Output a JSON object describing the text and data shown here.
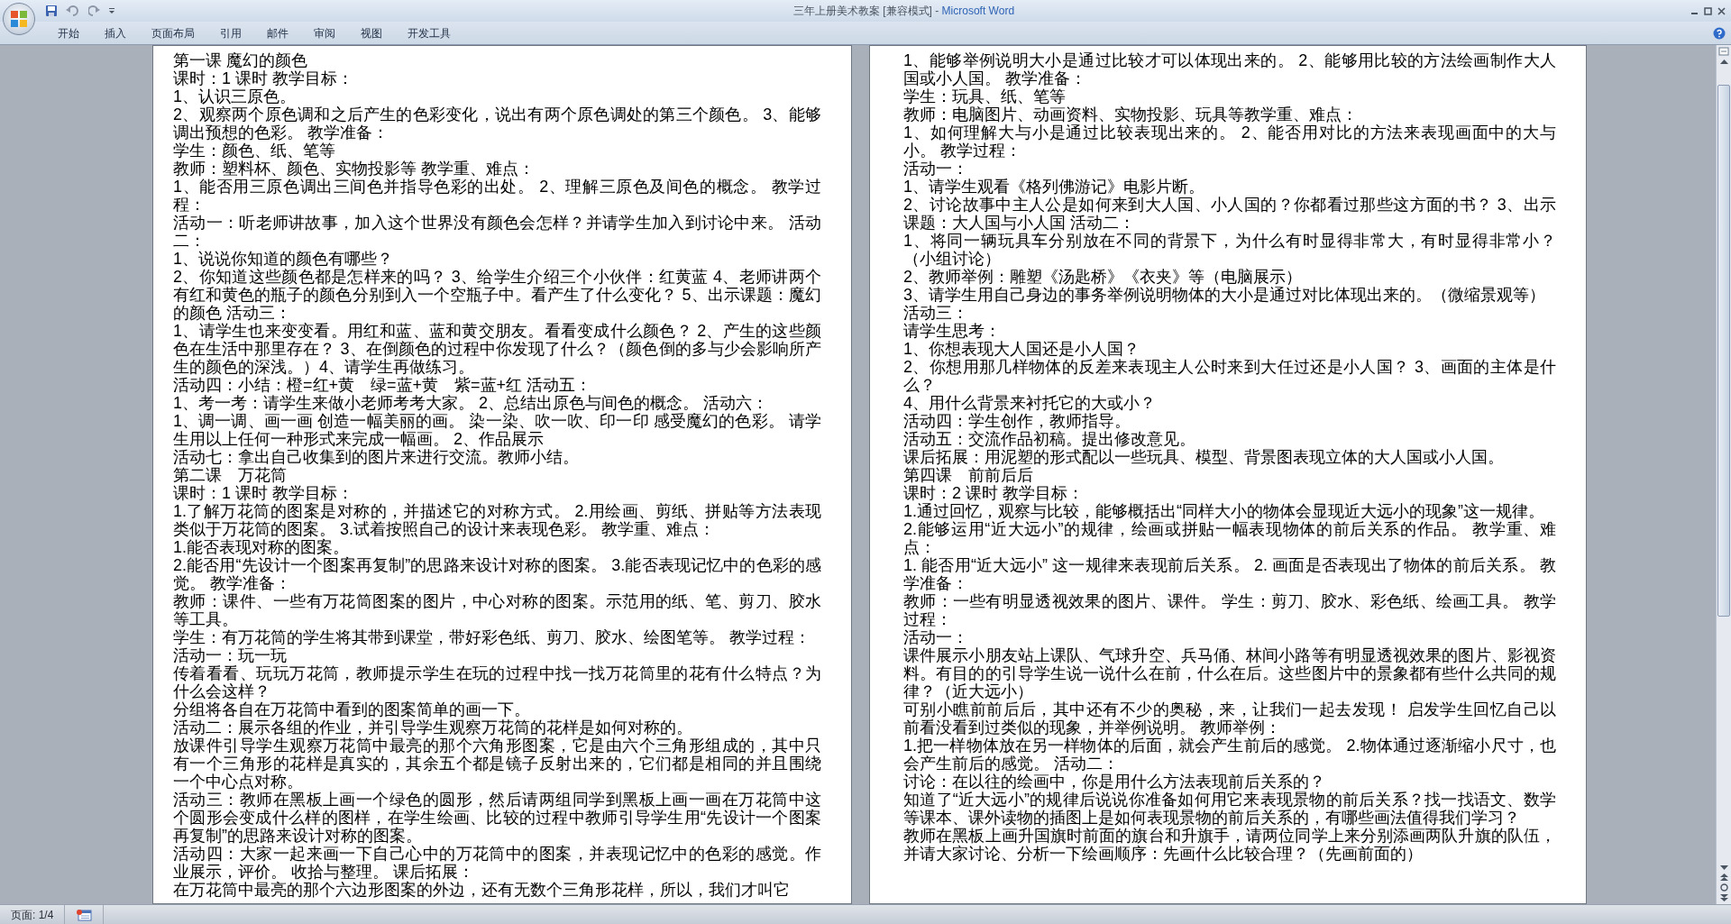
{
  "window": {
    "title": "三年上册美术教案 [兼容模式] -",
    "app": "Microsoft Word"
  },
  "ribbon_tabs": [
    {
      "label": "开始",
      "selected": false
    },
    {
      "label": "插入",
      "selected": false
    },
    {
      "label": "页面布局",
      "selected": false
    },
    {
      "label": "引用",
      "selected": false
    },
    {
      "label": "邮件",
      "selected": false
    },
    {
      "label": "审阅",
      "selected": false
    },
    {
      "label": "视图",
      "selected": false
    },
    {
      "label": "开发工具",
      "selected": false
    }
  ],
  "pages": [
    {
      "paragraphs": [
        "第一课 魔幻的颜色",
        "课时：1 课时 教学目标：",
        "1、认识三原色。",
        "2、观察两个原色调和之后产生的色彩变化，说出有两个原色调处的第三个颜色。 3、能够调出预想的色彩。 教学准备：",
        "学生：颜色、纸、笔等",
        "教师：塑料杯、颜色、实物投影等 教学重、难点：",
        "1、能否用三原色调出三间色并指导色彩的出处。 2、理解三原色及间色的概念。 教学过程：",
        "活动一：听老师讲故事，加入这个世界没有颜色会怎样？并请学生加入到讨论中来。 活动二：",
        "1、说说你知道的颜色有哪些？",
        "2、你知道这些颜色都是怎样来的吗？ 3、给学生介绍三个小伙伴：红黄蓝 4、老师讲两个有红和黄色的瓶子的颜色分别到入一个空瓶子中。看产生了什么变化？ 5、出示课题：魔幻的颜色 活动三：",
        "1、请学生也来变变看。用红和蓝、蓝和黄交朋友。看看变成什么颜色？ 2、产生的这些颜色在生活中那里存在？ 3、在倒颜色的过程中你发现了什么？（颜色倒的多与少会影响所产生的颜色的深浅。）4、请学生再做练习。",
        "活动四：小结：橙=红+黄　绿=蓝+黄　紫=蓝+红 活动五：",
        "1、考一考：请学生来做小老师考考大家。 2、总结出原色与间色的概念。 活动六：",
        "1、调一调、画一画 创造一幅美丽的画。 染一染、吹一吹、印一印 感受魔幻的色彩。 请学生用以上任何一种形式来完成一幅画。 2、作品展示",
        "活动七：拿出自己收集到的图片来进行交流。教师小结。",
        "第二课　万花筒",
        "课时：1 课时 教学目标：",
        "1.了解万花筒的图案是对称的，并描述它的对称方式。 2.用绘画、剪纸、拼贴等方法表现类似于万花筒的图案。 3.试着按照自己的设计来表现色彩。 教学重、难点：",
        "1.能否表现对称的图案。",
        "2.能否用“先设计一个图案再复制”的思路来设计对称的图案。 3.能否表现记忆中的色彩的感觉。 教学准备：",
        "教师：课件、一些有万花筒图案的图片，中心对称的图案。示范用的纸、笔、剪刀、胶水等工具。",
        "学生：有万花筒的学生将其带到课堂，带好彩色纸、剪刀、胶水、绘图笔等。 教学过程：",
        "活动一：玩一玩",
        "传着看看、玩玩万花筒，教师提示学生在玩的过程中找一找万花筒里的花有什么特点？为什么会这样？",
        "分组将各自在万花筒中看到的图案简单的画一下。",
        "活动二：展示各组的作业，并引导学生观察万花筒的花样是如何对称的。",
        "放课件引导学生观察万花筒中最亮的那个六角形图案，它是由六个三角形组成的，其中只有一个三角形的花样是真实的，其余五个都是镜子反射出来的，它们都是相同的并且围绕一个中心点对称。",
        "活动三：教师在黑板上画一个绿色的圆形，然后请两组同学到黑板上画一画在万花筒中这个圆形会变成什么样的图样，在学生绘画、比较的过程中教师引导学生用“先设计一个图案再复制”的思路来设计对称的图案。",
        "活动四：大家一起来画一下自己心中的万花筒中的图案，并表现记忆中的色彩的感觉。作业展示，评价。 收拾与整理。 课后拓展：",
        "在万花筒中最亮的那个六边形图案的外边，还有无数个三角形花样，所以，我们才叫它"
      ]
    },
    {
      "paragraphs": [
        "1、能够举例说明大小是通过比较才可以体现出来的。 2、能够用比较的方法绘画制作大人国或小人国。 教学准备：",
        "学生：玩具、纸、笔等",
        "教师：电脑图片、动画资料、实物投影、玩具等教学重、难点：",
        "1、如何理解大与小是通过比较表现出来的。 2、能否用对比的方法来表现画面中的大与小。 教学过程：",
        "活动一：",
        "1、请学生观看《格列佛游记》电影片断。",
        "2、讨论故事中主人公是如何来到大人国、小人国的？你都看过那些这方面的书？ 3、出示课题：大人国与小人国 活动二：",
        "1、将同一辆玩具车分别放在不同的背景下，为什么有时显得非常大，有时显得非常小？（小组讨论）",
        "2、教师举例：雕塑《汤匙桥》《衣夹》等（电脑展示）",
        "3、请学生用自己身边的事务举例说明物体的大小是通过对比体现出来的。（微缩景观等）",
        "活动三：",
        "请学生思考：",
        "1、你想表现大人国还是小人国？",
        "2、你想用那几样物体的反差来表现主人公时来到大任过还是小人国？ 3、画面的主体是什么？",
        "4、用什么背景来衬托它的大或小？",
        "活动四：学生创作，教师指导。",
        "活动五：交流作品初稿。提出修改意见。",
        "课后拓展：用泥塑的形式配以一些玩具、模型、背景图表现立体的大人国或小人国。",
        "第四课　前前后后",
        "课时：2 课时 教学目标：",
        "1.通过回忆，观察与比较，能够概括出“同样大小的物体会显现近大远小的现象”这一规律。",
        "2.能够运用“近大远小”的规律，绘画或拼贴一幅表现物体的前后关系的作品。 教学重、难点：",
        "1. 能否用“近大远小” 这一规律来表现前后关系。 2. 画面是否表现出了物体的前后关系。 教学准备：",
        "教师：一些有明显透视效果的图片、课件。 学生：剪刀、胶水、彩色纸、绘画工具。 教学过程：",
        "活动一：",
        "课件展示小朋友站上课队、气球升空、兵马俑、林间小路等有明显透视效果的图片、影视资料。有目的的引导学生说一说什么在前，什么在后。这些图片中的景象都有些什么共同的规律？（近大远小）",
        "可别小瞧前前后后，其中还有不少的奥秘，来，让我们一起去发现！ 启发学生回忆自己以前看没看到过类似的现象，并举例说明。 教师举例：",
        "1.把一样物体放在另一样物体的后面，就会产生前后的感觉。 2.物体通过逐渐缩小尺寸，也会产生前后的感觉。 活动二：",
        "讨论：在以往的绘画中，你是用什么方法表现前后关系的？",
        "知道了“近大远小”的规律后说说你准备如何用它来表现景物的前后关系？找一找语文、数学等课本、课外读物的插图上是如何表现景物的前后关系的，有哪些画法值得我们学习？",
        "教师在黑板上画升国旗时前面的旗台和升旗手，请两位同学上来分别添画两队升旗的队伍，并请大家讨论、分析一下绘画顺序：先画什么比较合理？（先画前面的）"
      ]
    }
  ],
  "status_bar": {
    "page": "页面: 1/4"
  }
}
